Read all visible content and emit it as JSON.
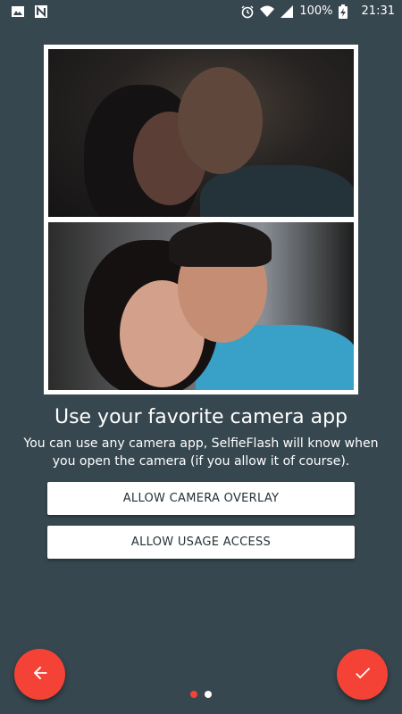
{
  "status_bar": {
    "battery": "100%",
    "time": "21:31",
    "icons": [
      "image-icon",
      "n-app-icon",
      "alarm-icon",
      "wifi-icon",
      "signal-icon",
      "battery-charging-icon"
    ]
  },
  "photos": [
    {
      "description_name": "selfie-photo-dark"
    },
    {
      "description_name": "selfie-photo-flash"
    }
  ],
  "onboarding": {
    "title": "Use your favorite camera app",
    "description": "You can use any camera app, SelfieFlash will know when you open the camera (if you allow it of course)."
  },
  "buttons": {
    "allow_overlay": "ALLOW CAMERA OVERLAY",
    "allow_usage": "ALLOW USAGE ACCESS"
  },
  "navigation": {
    "back_icon": "arrow-left-icon",
    "done_icon": "check-icon",
    "page_indicator": {
      "total": 2,
      "current": 1
    }
  },
  "colors": {
    "background": "#37474f",
    "accent": "#f44336",
    "dot_active": "#f44336",
    "dot_inactive": "#ffffff"
  }
}
